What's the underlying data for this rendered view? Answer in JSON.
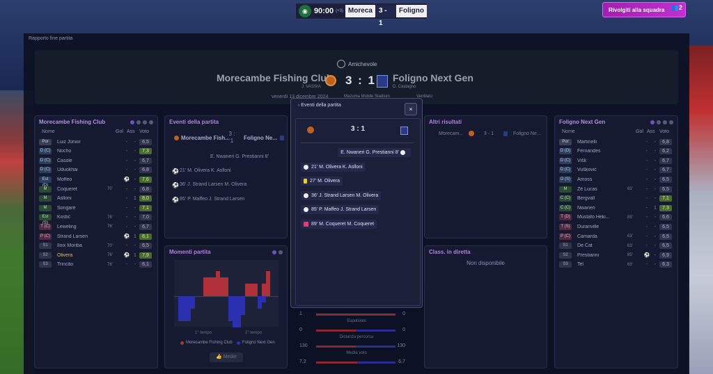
{
  "topbar": {
    "clock": "90:00",
    "extra": "(+3)",
    "home": "Moreca",
    "score": "3 - 1",
    "away": "Foligno"
  },
  "team_button": {
    "label": "Rivolgiti alla squadra",
    "badge": "2"
  },
  "breadcrumb": "Rapporto fine partita",
  "match": {
    "competition": "Amichevole",
    "home_team": "Morecambe Fishing Club",
    "away_team": "Foligno Next Gen",
    "score": "3 : 1",
    "home_coach": "J. VASSIA",
    "away_coach": "D. Castagno",
    "date": "venerdì 13 dicembre 2024",
    "stadium": "Mazuma Mobile Stadium",
    "weather": "Ventilato"
  },
  "home_panel": {
    "title": "Morecambe Fishing Club",
    "headers": {
      "name": "Nome",
      "goals": "Gol",
      "assists": "Ass",
      "rating": "Voto"
    },
    "players": [
      {
        "pos": "Por",
        "name": "Luiz Júnior",
        "g": "-",
        "a": "-",
        "sub": "",
        "r": "6,5"
      },
      {
        "pos": "D (C)",
        "name": "Nocho",
        "g": "-",
        "a": "-",
        "sub": "",
        "r": "7,3"
      },
      {
        "pos": "D (C)",
        "name": "Casole",
        "g": "-",
        "a": "-",
        "sub": "",
        "r": "6,7"
      },
      {
        "pos": "D (C)",
        "name": "Uduokhai",
        "g": "-",
        "a": "-",
        "sub": "",
        "r": "6,8"
      },
      {
        "pos": "Est (D)",
        "name": "Moffeo",
        "g": "⚽",
        "a": "-",
        "sub": "",
        "r": "7,6"
      },
      {
        "pos": "M",
        "name": "Coqueret",
        "g": "-",
        "a": "-",
        "sub": "70'",
        "r": "6,8"
      },
      {
        "pos": "M",
        "name": "Aslloni",
        "g": "-",
        "a": "1",
        "sub": "",
        "r": "8,0"
      },
      {
        "pos": "M",
        "name": "Songaré",
        "g": "-",
        "a": "-",
        "sub": "",
        "r": "7,1"
      },
      {
        "pos": "Est (S)",
        "name": "Kostić",
        "g": "-",
        "a": "-",
        "sub": "76'",
        "r": "7,0"
      },
      {
        "pos": "T (C)",
        "name": "Leweling",
        "g": "-",
        "a": "-",
        "sub": "76'",
        "r": "6,7"
      },
      {
        "pos": "P (C)",
        "name": "Strand Larsen",
        "g": "⚽",
        "a": "1",
        "sub": "",
        "r": "8,1"
      },
      {
        "pos": "S1",
        "name": "Iloix Moriba",
        "g": "-",
        "a": "-",
        "sub": "70'",
        "r": "6,5"
      },
      {
        "pos": "S2",
        "name": "Olivera",
        "g": "⚽",
        "a": "1",
        "sub": "76'",
        "r": "7,9",
        "hl": true
      },
      {
        "pos": "S3",
        "name": "Trincão",
        "g": "-",
        "a": "-",
        "sub": "76'",
        "r": "6,1"
      }
    ]
  },
  "away_panel": {
    "title": "Foligno Next Gen",
    "headers": {
      "name": "Nome",
      "goals": "Gol",
      "assists": "Ass",
      "rating": "Voto"
    },
    "players": [
      {
        "pos": "Por",
        "name": "Martinelli",
        "g": "-",
        "a": "-",
        "sub": "",
        "r": "6,8"
      },
      {
        "pos": "D (D)",
        "name": "Fernandes",
        "g": "-",
        "a": "-",
        "sub": "",
        "r": "6,2"
      },
      {
        "pos": "D (C)",
        "name": "Višk",
        "g": "-",
        "a": "-",
        "sub": "",
        "r": "6,7"
      },
      {
        "pos": "D (C)",
        "name": "Vušković",
        "g": "-",
        "a": "-",
        "sub": "",
        "r": "6,7"
      },
      {
        "pos": "D (S)",
        "name": "Amoss",
        "g": "-",
        "a": "-",
        "sub": "",
        "r": "6,5"
      },
      {
        "pos": "M",
        "name": "Zé Lucas",
        "g": "-",
        "a": "-",
        "sub": "63'",
        "r": "6,5"
      },
      {
        "pos": "C (C)",
        "name": "Bergvall",
        "g": "-",
        "a": "-",
        "sub": "",
        "r": "7,1"
      },
      {
        "pos": "C (C)",
        "name": "Nwaneri",
        "g": "-",
        "a": "1",
        "sub": "",
        "r": "7,3"
      },
      {
        "pos": "T (D)",
        "name": "Mustafo Heki...",
        "g": "-",
        "a": "-",
        "sub": "85'",
        "r": "6,6"
      },
      {
        "pos": "T (S)",
        "name": "Duranville",
        "g": "-",
        "a": "-",
        "sub": "",
        "r": "6,5"
      },
      {
        "pos": "P (C)",
        "name": "Camarda",
        "g": "-",
        "a": "-",
        "sub": "63'",
        "r": "6,5"
      },
      {
        "pos": "S1",
        "name": "De Cat",
        "g": "-",
        "a": "-",
        "sub": "63'",
        "r": "6,5"
      },
      {
        "pos": "S2",
        "name": "Prestianni",
        "g": "⚽",
        "a": "-",
        "sub": "85'",
        "r": "6,9"
      },
      {
        "pos": "S3",
        "name": "Tel",
        "g": "-",
        "a": "-",
        "sub": "63'",
        "r": "6,3"
      }
    ]
  },
  "events_panel": {
    "title": "Eventi della partita",
    "home_short": "Morecambe Fish...",
    "away_short": "Foligno Ne...",
    "score_top": "3 :",
    "score_bottom": "1",
    "events": [
      "E. Nwaneri G. Prestianni 8'",
      "21' M. Olivera K. Aslloni",
      "36' J. Strand Larsen M. Olivera",
      "85' P. Maffeo J. Strand Larsen"
    ]
  },
  "moments_panel": {
    "title": "Momenti partita",
    "first_half": "1° tempo",
    "second_half": "2° tempo",
    "legend_home": "Morecambe Fishing Club",
    "legend_away": "Foligno Next Gen",
    "averages_button": "Medie"
  },
  "modal": {
    "title": "Eventi della partita",
    "close": "×",
    "score": "3 : 1",
    "events": [
      {
        "text": "E. Nwaneri G. Prestianni 8'",
        "type": "goal",
        "side": "away"
      },
      {
        "text": "21' M. Olivera K. Aslloni",
        "type": "goal",
        "side": "home"
      },
      {
        "text": "27' M. Olivera",
        "type": "yellow",
        "side": "home"
      },
      {
        "text": "36' J. Strand Larsen M. Olivera",
        "type": "goal",
        "side": "home"
      },
      {
        "text": "85' P. Maffeo J. Strand Larsen",
        "type": "goal",
        "side": "home"
      },
      {
        "text": "89' M. Coqueret M. Coqueret",
        "type": "sub",
        "side": "home"
      }
    ]
  },
  "stats": [
    {
      "home": "1",
      "away": "0",
      "label": "Espulsioni",
      "home_share": 1.0
    },
    {
      "home": "0",
      "away": "0",
      "label": "Distanza percorsa",
      "home_share": 0.5
    },
    {
      "home": "130",
      "away": "130",
      "label": "Media voto",
      "home_share": 0.5
    },
    {
      "home": "7,2",
      "away": "6,7",
      "label": "",
      "home_share": 0.52
    }
  ],
  "other_results": {
    "title": "Altri risultati",
    "home": "Morecam...",
    "score": "3 - 1",
    "away": "Foligno Ne..."
  },
  "live_table": {
    "title": "Class. in diretta",
    "empty": "Non disponibile"
  },
  "chart_data": {
    "type": "bar",
    "title": "Momenti partita",
    "x_labels": [
      "1° tempo",
      "2° tempo"
    ],
    "series": [
      {
        "name": "Morecambe Fishing Club",
        "values": [
          0,
          0,
          0,
          0,
          0,
          0,
          3,
          3,
          3,
          4,
          3,
          3,
          0,
          0,
          0,
          0,
          2,
          2,
          2,
          0,
          2,
          4,
          0,
          0
        ]
      },
      {
        "name": "Foligno Next Gen",
        "values": [
          -4,
          -4,
          -4,
          -2,
          0,
          0,
          0,
          0,
          0,
          0,
          0,
          0,
          -4,
          -5,
          -5,
          -3,
          0,
          0,
          0,
          -2,
          -1,
          0,
          0,
          0
        ]
      }
    ],
    "ylim": [
      -6,
      5
    ]
  },
  "colors": {
    "accent": "#9a70e0",
    "home": "#b0303a",
    "away": "#2a30b0",
    "button": "#c030d0"
  }
}
